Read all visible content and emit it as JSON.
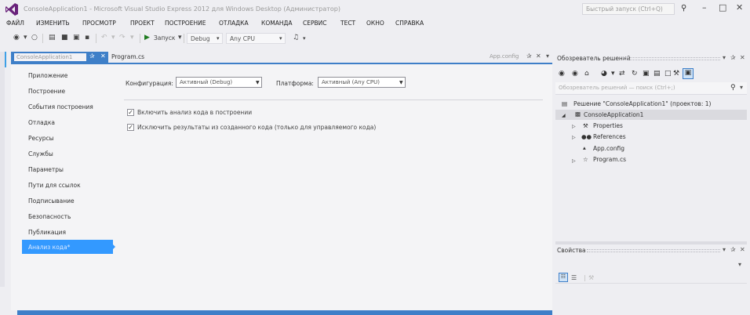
{
  "window": {
    "title": "ConsoleApplication1 - Microsoft Visual Studio Express 2012 для Windows Desktop (Администратор)",
    "quick_launch_placeholder": "Быстрый запуск (Ctrl+Q)"
  },
  "menu": [
    "ФАЙЛ",
    "ИЗМЕНИТЬ",
    "ПРОСМОТР",
    "ПРОЕКТ",
    "ПОСТРОЕНИЕ",
    "ОТЛАДКА",
    "КОМАНДА",
    "СЕРВИС",
    "ТЕСТ",
    "ОКНО",
    "СПРАВКА"
  ],
  "toolbar": {
    "start_label": "Запуск",
    "config_value": "Debug",
    "platform_value": "Any CPU"
  },
  "doc_tabs": {
    "active_tab": "ConsoleApplication1",
    "second_tab": "Program.cs",
    "right_tab": "App.config"
  },
  "nav": {
    "items": [
      "Приложение",
      "Построение",
      "События построения",
      "Отладка",
      "Ресурсы",
      "Службы",
      "Параметры",
      "Пути для ссылок",
      "Подписывание",
      "Безопасность",
      "Публикация"
    ],
    "selected": "Анализ кода*"
  },
  "form": {
    "config_label": "Конфигурация:",
    "config_value": "Активный (Debug)",
    "platform_label": "Платформа:",
    "platform_value": "Активный (Any CPU)",
    "check1_label": "Включить анализ кода в построении",
    "check2_label": "Исключить результаты из созданного кода (только для управляемого кода)"
  },
  "solution_explorer": {
    "title": "Обозреватель решений",
    "search_placeholder": "Обозреватель решений — поиск (Ctrl+;)",
    "solution_label": "Решение \"ConsoleApplication1\" (проектов: 1)",
    "project_label": "ConsoleApplication1",
    "items": [
      "Properties",
      "References",
      "App.config",
      "Program.cs"
    ]
  },
  "properties": {
    "title": "Свойства"
  }
}
